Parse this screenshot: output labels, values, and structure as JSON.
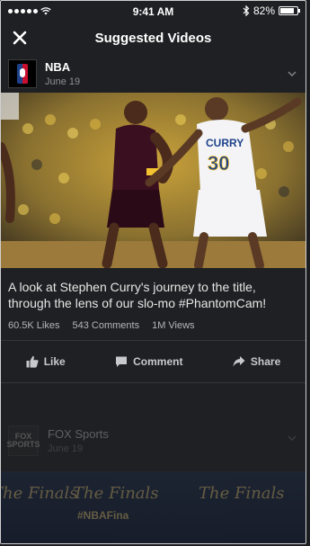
{
  "status_bar": {
    "time": "9:41 AM",
    "battery_text": "82%",
    "battery_level": 0.82
  },
  "header": {
    "title": "Suggested Videos"
  },
  "post": {
    "page_name": "NBA",
    "date": "June 19",
    "caption": "A look at Stephen Curry's journey to the title, through the lens of our slo-mo #PhantomCam!",
    "likes": "60.5K Likes",
    "comments": "543 Comments",
    "views": "1M Views",
    "jersey_name": "CURRY",
    "jersey_number": "30",
    "actions": {
      "like": "Like",
      "comment": "Comment",
      "share": "Share"
    }
  },
  "next_post": {
    "page_name": "FOX Sports",
    "date": "June 19",
    "logo_text": "FOX SPORTS",
    "banner_text": "The Finals",
    "hashtag": "#NBAFina"
  }
}
